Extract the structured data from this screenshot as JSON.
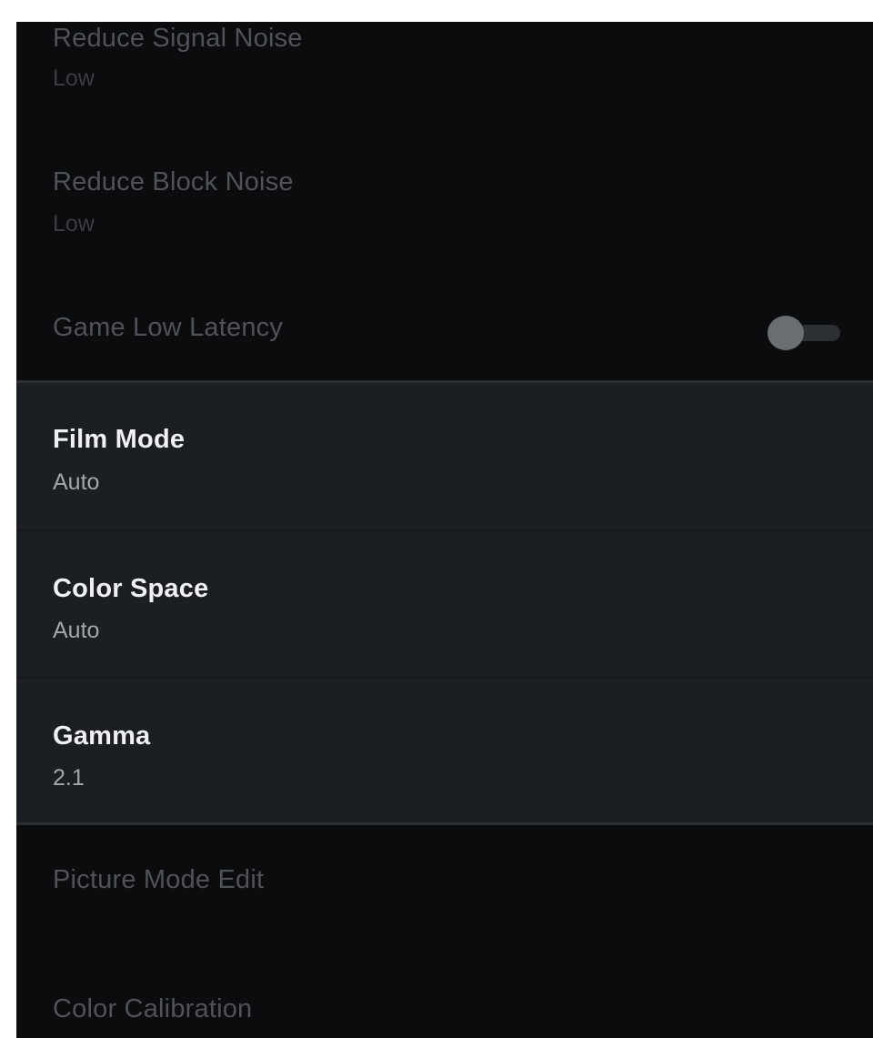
{
  "settings": {
    "reduce_signal_noise": {
      "label": "Reduce Signal Noise",
      "value": "Low"
    },
    "reduce_block_noise": {
      "label": "Reduce Block Noise",
      "value": "Low"
    },
    "game_low_latency": {
      "label": "Game Low Latency",
      "enabled": false
    },
    "film_mode": {
      "label": "Film Mode",
      "value": "Auto"
    },
    "color_space": {
      "label": "Color Space",
      "value": "Auto"
    },
    "gamma": {
      "label": "Gamma",
      "value": "2.1"
    },
    "picture_mode_edit": {
      "label": "Picture Mode Edit"
    },
    "color_calibration": {
      "label": "Color Calibration"
    }
  },
  "colors": {
    "background": "#0b0c0e",
    "active_panel": "#1b1e22",
    "dim_text": "#4f5359",
    "active_text": "#eef0f2"
  }
}
